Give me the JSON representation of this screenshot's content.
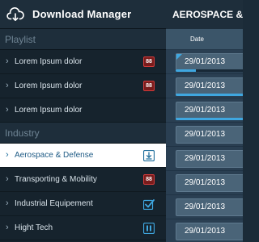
{
  "app": {
    "title": "Download Manager"
  },
  "sections": {
    "playlist": "Playlist",
    "industry": "Industry"
  },
  "playlist_items": [
    {
      "label": "Lorem Ipsum dolor",
      "badge": "88"
    },
    {
      "label": "Lorem Ipsum dolor",
      "badge": "88"
    },
    {
      "label": "Lorem Ipsum dolor"
    }
  ],
  "industry_items": [
    {
      "label": "Aerospace & Defense",
      "icon": "download-icon",
      "active": true
    },
    {
      "label": "Transporting & Mobility",
      "badge": "88"
    },
    {
      "label": "Industrial Equipement",
      "icon": "checkbox-checked-icon"
    },
    {
      "label": "Hight Tech",
      "icon": "pause-icon"
    }
  ],
  "main": {
    "title": "AEROSPACE & DEFENSE",
    "column": "Date",
    "rows": [
      {
        "date": "29/01/2013",
        "progress": 0.25
      },
      {
        "date": "29/01/2013",
        "progress": 1.0
      },
      {
        "date": "29/01/2013",
        "progress": 1.0
      },
      {
        "date": "29/01/2013"
      },
      {
        "date": "29/01/2013"
      },
      {
        "date": "29/01/2013"
      },
      {
        "date": "29/01/2013"
      },
      {
        "date": "29/01/2013"
      }
    ]
  },
  "colors": {
    "accent": "#3fa7e0",
    "badge": "#d23b3b",
    "panel": "#16232d"
  }
}
